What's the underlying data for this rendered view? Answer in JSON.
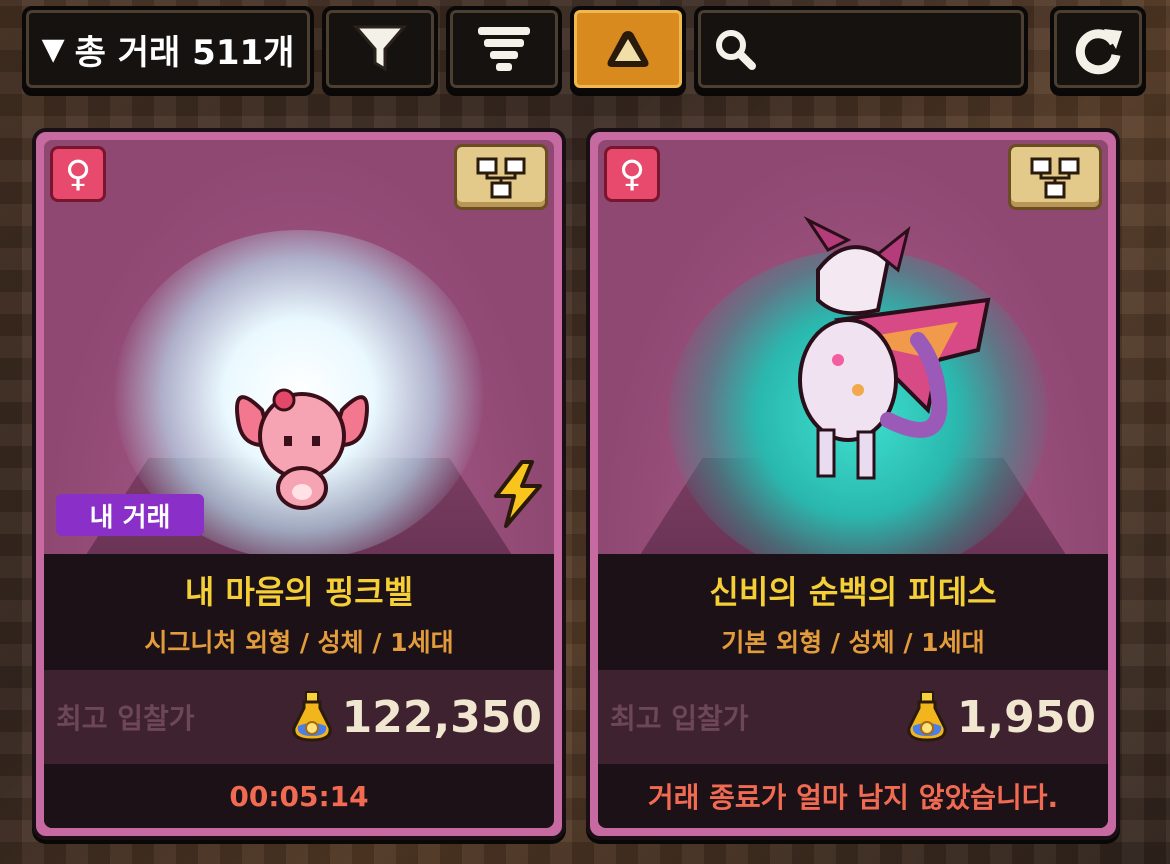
{
  "toolbar": {
    "count_arrow": "▼",
    "count_label": "총 거래 511개",
    "search_placeholder": "",
    "active_color": "#d88a1e"
  },
  "cards": [
    {
      "sex_symbol": "♀",
      "my_trade_label": "내 거래",
      "name": "내 마음의 핑크벨",
      "subtitle": "시그니처 외형 / 성체 / 1세대",
      "bid_label": "최고 입찰가",
      "bid_value": "122,350",
      "status": "00:05:14",
      "glow": "white"
    },
    {
      "sex_symbol": "♀",
      "name": "신비의 순백의 피데스",
      "subtitle": "기본 외형 / 성체 / 1세대",
      "bid_label": "최고 입찰가",
      "bid_value": "1,950",
      "status": "거래 종료가 얼마 남지 않았습니다.",
      "glow": "teal"
    }
  ]
}
